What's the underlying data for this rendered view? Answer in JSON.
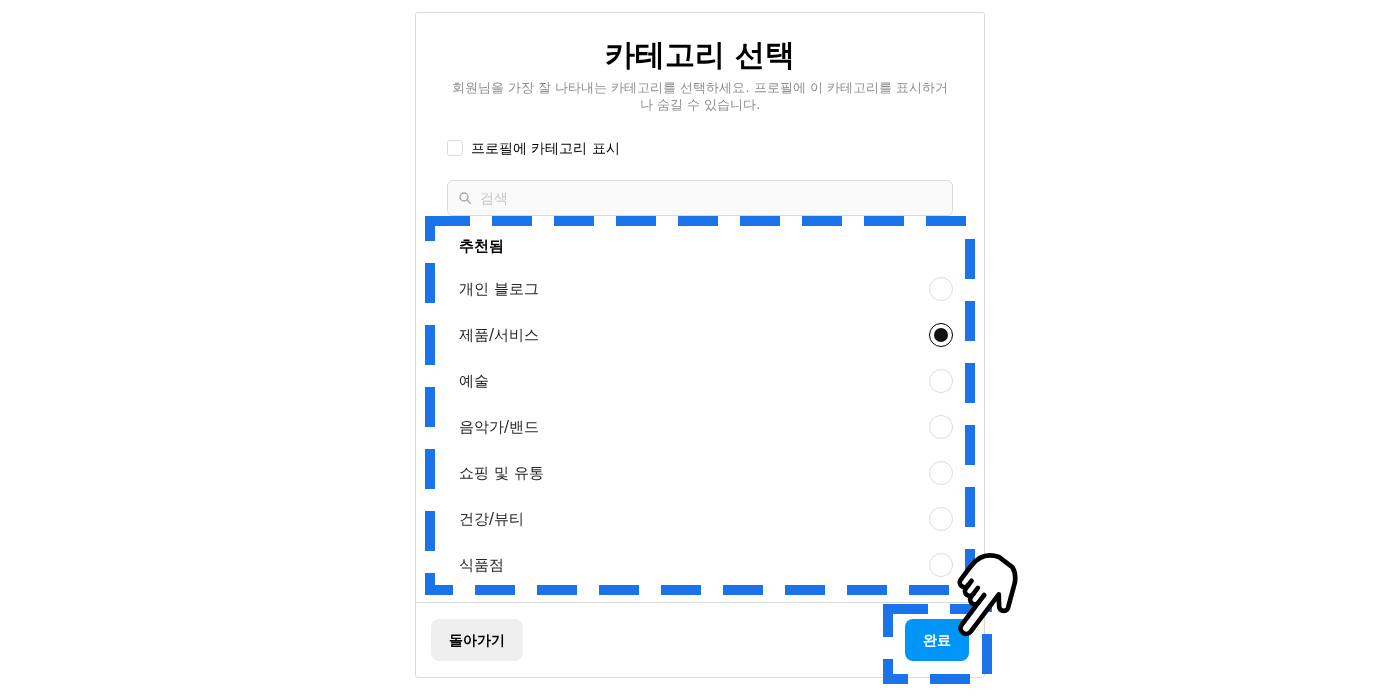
{
  "dialog": {
    "title": "카테고리 선택",
    "description": "회원님을 가장 잘 나타내는 카테고리를 선택하세요. 프로필에 이 카테고리를 표시하거나 숨길 수 있습니다.",
    "show_on_profile": {
      "label": "프로필에 카테고리 표시",
      "checked": false
    },
    "search": {
      "placeholder": "검색"
    },
    "list": {
      "highlighted": true,
      "heading": "추천됨",
      "items": [
        {
          "label": "개인 블로그",
          "selected": false
        },
        {
          "label": "제품/서비스",
          "selected": true
        },
        {
          "label": "예술",
          "selected": false
        },
        {
          "label": "음악가/밴드",
          "selected": false
        },
        {
          "label": "쇼핑 및 유통",
          "selected": false
        },
        {
          "label": "건강/뷰티",
          "selected": false
        },
        {
          "label": "식품점",
          "selected": false
        }
      ]
    },
    "buttons": [
      {
        "kind": "secondary",
        "label": "돌아가기",
        "highlighted": false,
        "pointer": false
      },
      {
        "kind": "primary",
        "label": "완료",
        "highlighted": true,
        "pointer": true
      }
    ]
  }
}
